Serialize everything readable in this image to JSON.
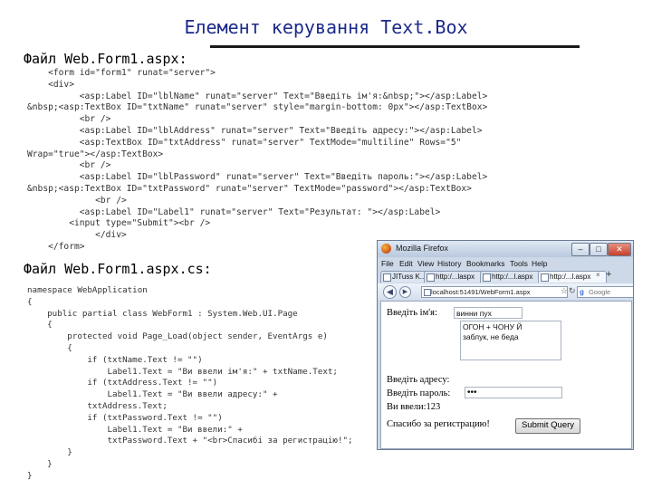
{
  "slide": {
    "title": "Елемент керування Text.Box",
    "aspx_label": "Файл Web.Form1.aspx:",
    "cs_label": "Файл Web.Form1.aspx.cs:"
  },
  "aspx_code": [
    "    <form id=\"form1\" runat=\"server\">",
    "    <div>",
    "          <asp:Label ID=\"lblName\" runat=\"server\" Text=\"Введіть ім'я:&nbsp;\"></asp:Label>",
    "&nbsp;<asp:TextBox ID=\"txtName\" runat=\"server\" style=\"margin-bottom: 0px\"></asp:TextBox>",
    "          <br />",
    "          <asp:Label ID=\"lblAddress\" runat=\"server\" Text=\"Введіть адресу:\"></asp:Label>",
    "          <asp:TextBox ID=\"txtAddress\" runat=\"server\" TextMode=\"multiline\" Rows=\"5\"",
    "Wrap=\"true\"></asp:TextBox>",
    "          <br />",
    "          <asp:Label ID=\"lblPassword\" runat=\"server\" Text=\"Введіть пароль:\"></asp:Label>",
    "&nbsp;<asp:TextBox ID=\"txtPassword\" runat=\"server\" TextMode=\"password\"></asp:TextBox>",
    "             <br />",
    "          <asp:Label ID=\"Label1\" runat=\"server\" Text=\"Результат: \"></asp:Label>",
    "        <input type=\"Submit\"><br />",
    "             </div>",
    "    </form>"
  ],
  "cs_code": [
    "namespace WebApplication",
    "{",
    "    public partial class WebForm1 : System.Web.UI.Page",
    "    {",
    "        protected void Page_Load(object sender, EventArgs e)",
    "        {",
    "            if (txtName.Text != \"\")",
    "                Label1.Text = \"Ви ввели ім'я:\" + txtName.Text;",
    "            if (txtAddress.Text != \"\")",
    "                Label1.Text = \"Ви ввели адресу:\" +",
    "            txtAddress.Text;",
    "            if (txtPassword.Text != \"\")",
    "                Label1.Text = \"Ви ввели:\" +",
    "                txtPassword.Text + \"<br>Спасибі за регистрацію!\";",
    "        }",
    "    }",
    "}"
  ],
  "browser": {
    "window_title": "Mozilla Firefox",
    "window_buttons": [
      "–",
      "□",
      "✕"
    ],
    "menu": [
      "File",
      "Edit",
      "View",
      "History",
      "Bookmarks",
      "Tools",
      "Help"
    ],
    "tabs": [
      {
        "label": "JITuss K..."
      },
      {
        "label": "http:/...laspx"
      },
      {
        "label": "http:/...l.aspx"
      },
      {
        "label": "http:/...l.aspx"
      }
    ],
    "new_tab": "+",
    "url": "localhost:51491/WebForm1.aspx",
    "search_placeholder": "Google",
    "search_glyph": "g",
    "form": {
      "name_label": "Введіть ім'я:",
      "name_value": "винни пух",
      "address_text": "ОГОН + ЧОНУ Й\nзаблук, не беда",
      "address_label": "Введіть адресу:",
      "password_label": "Введіть пароль:",
      "password_value": "•••",
      "result_text": "Ви ввели:123",
      "thanks_text": "Спасибо за регистрацию!",
      "submit_label": "Submit Query"
    },
    "colors": {
      "frame": "#cdd9e8",
      "close_button": "#c7412a"
    }
  }
}
